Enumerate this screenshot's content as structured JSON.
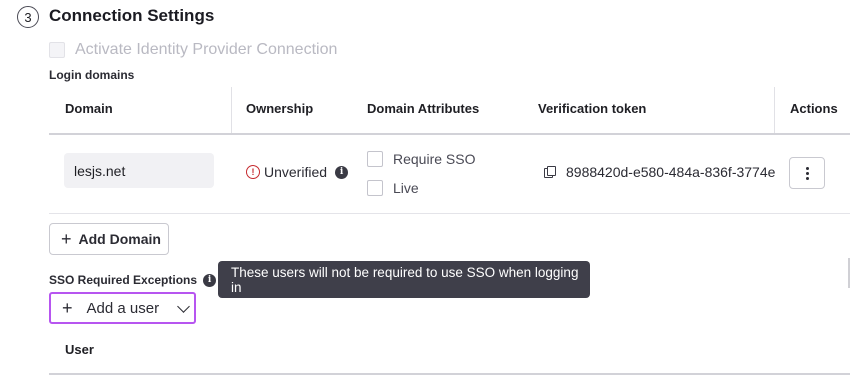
{
  "section": {
    "step": "3",
    "title": "Connection Settings"
  },
  "activate": {
    "label": "Activate Identity Provider Connection",
    "checked": false,
    "disabled": true
  },
  "login_domains": {
    "label": "Login domains",
    "headers": {
      "domain": "Domain",
      "ownership": "Ownership",
      "attributes": "Domain Attributes",
      "token": "Verification token",
      "actions": "Actions"
    },
    "rows": [
      {
        "domain": "lesjs.net",
        "ownership": "Unverified",
        "attributes": {
          "require_sso": "Require SSO",
          "live": "Live"
        },
        "token": "8988420d-e580-484a-836f-3774e"
      }
    ]
  },
  "add_domain_label": "Add Domain",
  "sso_exceptions": {
    "label": "SSO Required Exceptions",
    "tooltip": "These users will not be required to use SSO when logging in",
    "add_user_label": "Add a user",
    "table_header_user": "User"
  },
  "icons": {
    "step": "step-circle",
    "warning": "warning-circle-icon",
    "info": "info-icon",
    "copy": "copy-icon",
    "kebab": "kebab-menu-icon",
    "plus": "plus-icon",
    "chevron": "chevron-down-icon"
  },
  "colors": {
    "accent_focus": "#b755f0",
    "warning": "#c62a2f",
    "tooltip_bg": "#3f3f4a"
  }
}
